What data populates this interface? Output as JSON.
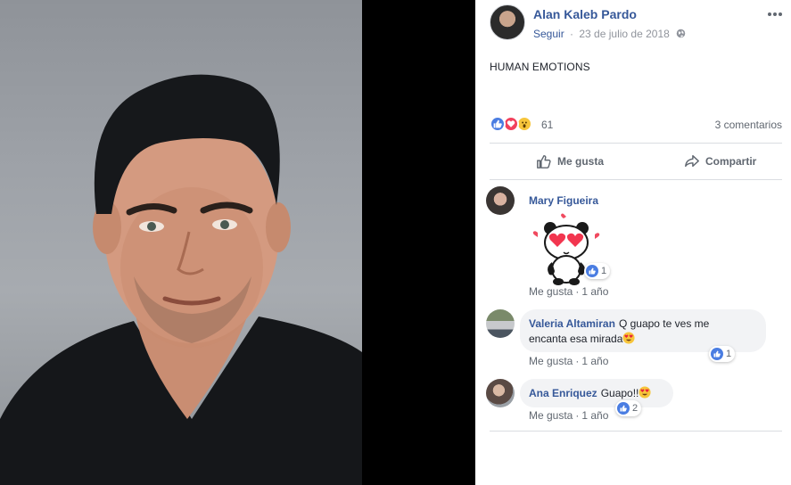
{
  "post": {
    "author": "Alan Kaleb Pardo",
    "follow_label": "Seguir",
    "separator": "·",
    "date": "23 de julio de 2018",
    "text": "HUMAN EMOTIONS",
    "reaction_count": "61",
    "comment_count": "3 comentarios",
    "reactions": [
      "like",
      "love",
      "wow"
    ]
  },
  "actions": {
    "like_label": "Me gusta",
    "share_label": "Compartir"
  },
  "comments": [
    {
      "name": "Mary Figueira",
      "text": "",
      "sticker": "panda-heart-eyes-sticker",
      "likes": "1",
      "like_label": "Me gusta",
      "time": "1 año"
    },
    {
      "name": "Valeria Altamiran",
      "text_line1": "Q guapo te ves me",
      "text_line2": "encanta esa mirada",
      "likes": "1",
      "like_label": "Me gusta",
      "time": "1 año"
    },
    {
      "name": "Ana Enriquez",
      "text": "Guapo!!",
      "likes": "2",
      "like_label": "Me gusta",
      "time": "1 año"
    }
  ],
  "colors": {
    "link": "#365899",
    "like_blue": "#4a7de2",
    "love_red": "#f2415c",
    "wow_yellow": "#f7c53b",
    "bubble": "#f2f3f5"
  }
}
